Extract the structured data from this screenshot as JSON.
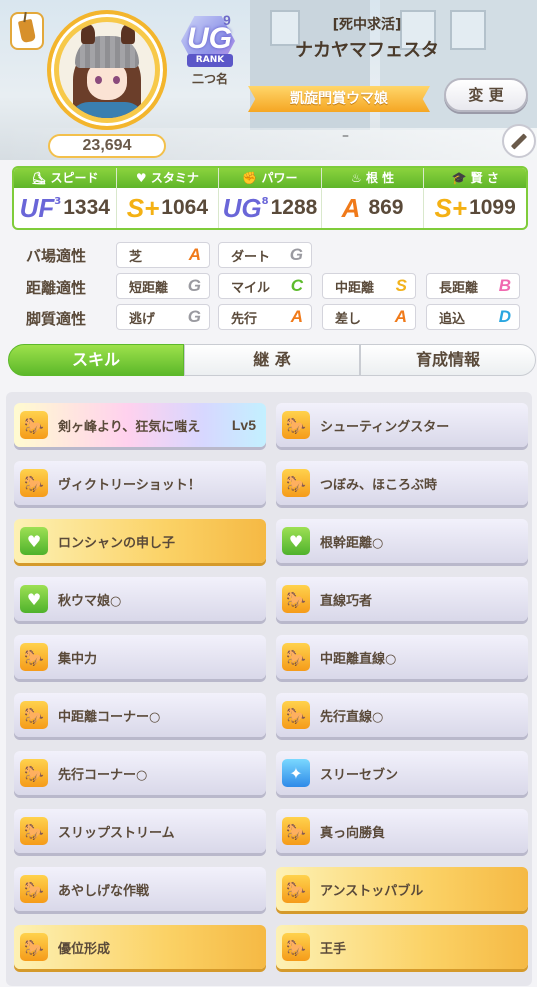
{
  "header": {
    "fans": "23,694",
    "rank": {
      "letter": "UG",
      "number": "9",
      "label": "RANK"
    },
    "nickname": "二つ名",
    "epithet": "[死中求活]",
    "name": "ナカヤマフェスタ",
    "title": "凱旋門賞ウマ娘",
    "change_label": "変 更",
    "comment": "–"
  },
  "stats": [
    {
      "label": "スピード",
      "grade": "UF",
      "grade_sub": "3",
      "value": "1334"
    },
    {
      "label": "スタミナ",
      "grade": "S+",
      "value": "1064"
    },
    {
      "label": "パワー",
      "grade": "UG",
      "grade_sub": "8",
      "value": "1288"
    },
    {
      "label": "根 性",
      "grade": "A",
      "value": "869"
    },
    {
      "label": "賢 さ",
      "grade": "S+",
      "value": "1099"
    }
  ],
  "aptitude": {
    "track_label": "バ場適性",
    "distance_label": "距離適性",
    "style_label": "脚質適性",
    "track": [
      {
        "name": "芝",
        "grade": "A"
      },
      {
        "name": "ダート",
        "grade": "G"
      }
    ],
    "distance": [
      {
        "name": "短距離",
        "grade": "G"
      },
      {
        "name": "マイル",
        "grade": "C"
      },
      {
        "name": "中距離",
        "grade": "S"
      },
      {
        "name": "長距離",
        "grade": "B"
      }
    ],
    "style": [
      {
        "name": "逃げ",
        "grade": "G"
      },
      {
        "name": "先行",
        "grade": "A"
      },
      {
        "name": "差し",
        "grade": "A"
      },
      {
        "name": "追込",
        "grade": "D"
      }
    ]
  },
  "tabs": {
    "skill": "スキル",
    "inherit": "継 承",
    "training": "育成情報"
  },
  "skills": [
    {
      "name": "剣ヶ峰より、狂気に嗤え",
      "level": "Lv5",
      "style": "rainbow",
      "icon": "orange"
    },
    {
      "name": "シューティングスター",
      "style": "normal",
      "icon": "orange"
    },
    {
      "name": "ヴィクトリーショット！",
      "style": "normal",
      "icon": "orange"
    },
    {
      "name": "つぼみ、ほころぶ時",
      "style": "normal",
      "icon": "orange"
    },
    {
      "name": "ロンシャンの申し子",
      "style": "gold",
      "icon": "green"
    },
    {
      "name": "根幹距離○",
      "style": "normal",
      "icon": "green"
    },
    {
      "name": "秋ウマ娘○",
      "style": "normal",
      "icon": "green"
    },
    {
      "name": "直線巧者",
      "style": "normal",
      "icon": "orange"
    },
    {
      "name": "集中力",
      "style": "normal",
      "icon": "orange"
    },
    {
      "name": "中距離直線○",
      "style": "normal",
      "icon": "orange"
    },
    {
      "name": "中距離コーナー○",
      "style": "normal",
      "icon": "orange"
    },
    {
      "name": "先行直線○",
      "style": "normal",
      "icon": "orange"
    },
    {
      "name": "先行コーナー○",
      "style": "normal",
      "icon": "orange"
    },
    {
      "name": "スリーセブン",
      "style": "normal",
      "icon": "blue"
    },
    {
      "name": "スリップストリーム",
      "style": "normal",
      "icon": "orange"
    },
    {
      "name": "真っ向勝負",
      "style": "normal",
      "icon": "orange"
    },
    {
      "name": "あやしげな作戦",
      "style": "normal",
      "icon": "orange"
    },
    {
      "name": "アンストッパブル",
      "style": "gold",
      "icon": "orange"
    },
    {
      "name": "優位形成",
      "style": "gold",
      "icon": "orange"
    },
    {
      "name": "王手",
      "style": "gold",
      "icon": "orange"
    }
  ],
  "colors": {
    "grade_A": "#f07a1a",
    "grade_G": "#9a9aa0",
    "grade_C": "#5dbb2c",
    "grade_S": "#f2b21c",
    "grade_B": "#f06ab0",
    "grade_D": "#2aa6e0",
    "grade_S_plus": "#f4b114",
    "grade_U": "#6a66d8"
  }
}
